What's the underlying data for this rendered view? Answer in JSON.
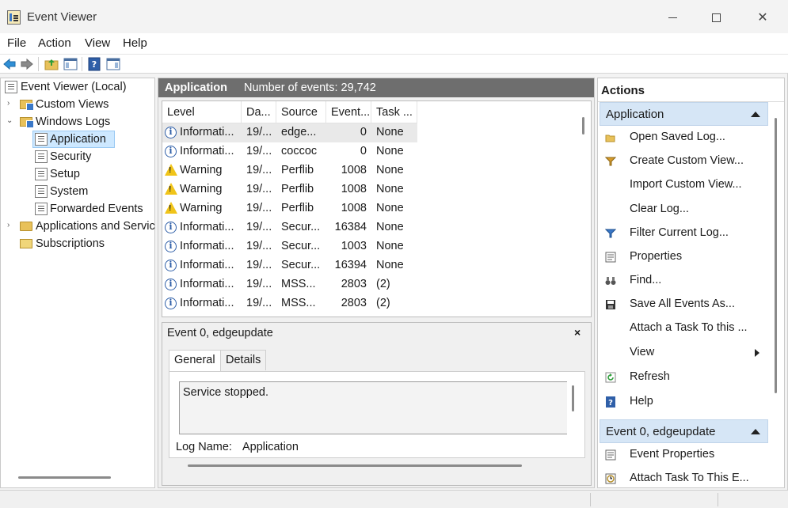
{
  "window": {
    "title": "Event Viewer"
  },
  "menu": [
    "File",
    "Action",
    "View",
    "Help"
  ],
  "tree": {
    "root": "Event Viewer (Local)",
    "custom_views": "Custom Views",
    "windows_logs": "Windows Logs",
    "application": "Application",
    "security": "Security",
    "setup": "Setup",
    "system": "System",
    "forwarded": "Forwarded Events",
    "apps_services": "Applications and Servic",
    "subscriptions": "Subscriptions"
  },
  "center": {
    "log_name": "Application",
    "event_count": "Number of events: 29,742",
    "columns": [
      "Level",
      "Da...",
      "Source",
      "Event...",
      "Task ..."
    ],
    "rows": [
      {
        "level": "Informati...",
        "type": "info",
        "date": "19/...",
        "source": "edge...",
        "event": "0",
        "task": "None"
      },
      {
        "level": "Informati...",
        "type": "info",
        "date": "19/...",
        "source": "coccoc",
        "event": "0",
        "task": "None"
      },
      {
        "level": "Warning",
        "type": "warning",
        "date": "19/...",
        "source": "Perflib",
        "event": "1008",
        "task": "None"
      },
      {
        "level": "Warning",
        "type": "warning",
        "date": "19/...",
        "source": "Perflib",
        "event": "1008",
        "task": "None"
      },
      {
        "level": "Warning",
        "type": "warning",
        "date": "19/...",
        "source": "Perflib",
        "event": "1008",
        "task": "None"
      },
      {
        "level": "Informati...",
        "type": "info",
        "date": "19/...",
        "source": "Secur...",
        "event": "16384",
        "task": "None"
      },
      {
        "level": "Informati...",
        "type": "info",
        "date": "19/...",
        "source": "Secur...",
        "event": "1003",
        "task": "None"
      },
      {
        "level": "Informati...",
        "type": "info",
        "date": "19/...",
        "source": "Secur...",
        "event": "16394",
        "task": "None"
      },
      {
        "level": "Informati...",
        "type": "info",
        "date": "19/...",
        "source": "MSS...",
        "event": "2803",
        "task": "(2)"
      },
      {
        "level": "Informati...",
        "type": "info",
        "date": "19/...",
        "source": "MSS...",
        "event": "2803",
        "task": "(2)"
      }
    ]
  },
  "detail": {
    "title": "Event 0, edgeupdate",
    "close": "×",
    "tab_general": "General",
    "tab_details": "Details",
    "message": "Service stopped.",
    "log_name_label": "Log Name:",
    "log_name_value": "Application"
  },
  "actions": {
    "title": "Actions",
    "section1": "Application",
    "items1": [
      "Open Saved Log...",
      "Create Custom View...",
      "Import Custom View...",
      "Clear Log...",
      "Filter Current Log...",
      "Properties",
      "Find...",
      "Save All Events As...",
      "Attach a Task To this ...",
      "View",
      "Refresh",
      "Help"
    ],
    "section2": "Event 0, edgeupdate",
    "items2": [
      "Event Properties",
      "Attach Task To This E..."
    ]
  },
  "colors": {
    "header_gray": "#6e6e6e",
    "selection": "#cde8ff",
    "section_blue": "#d6e6f6",
    "info_blue": "#2f5fa8",
    "warning_yellow": "#f0c419"
  }
}
